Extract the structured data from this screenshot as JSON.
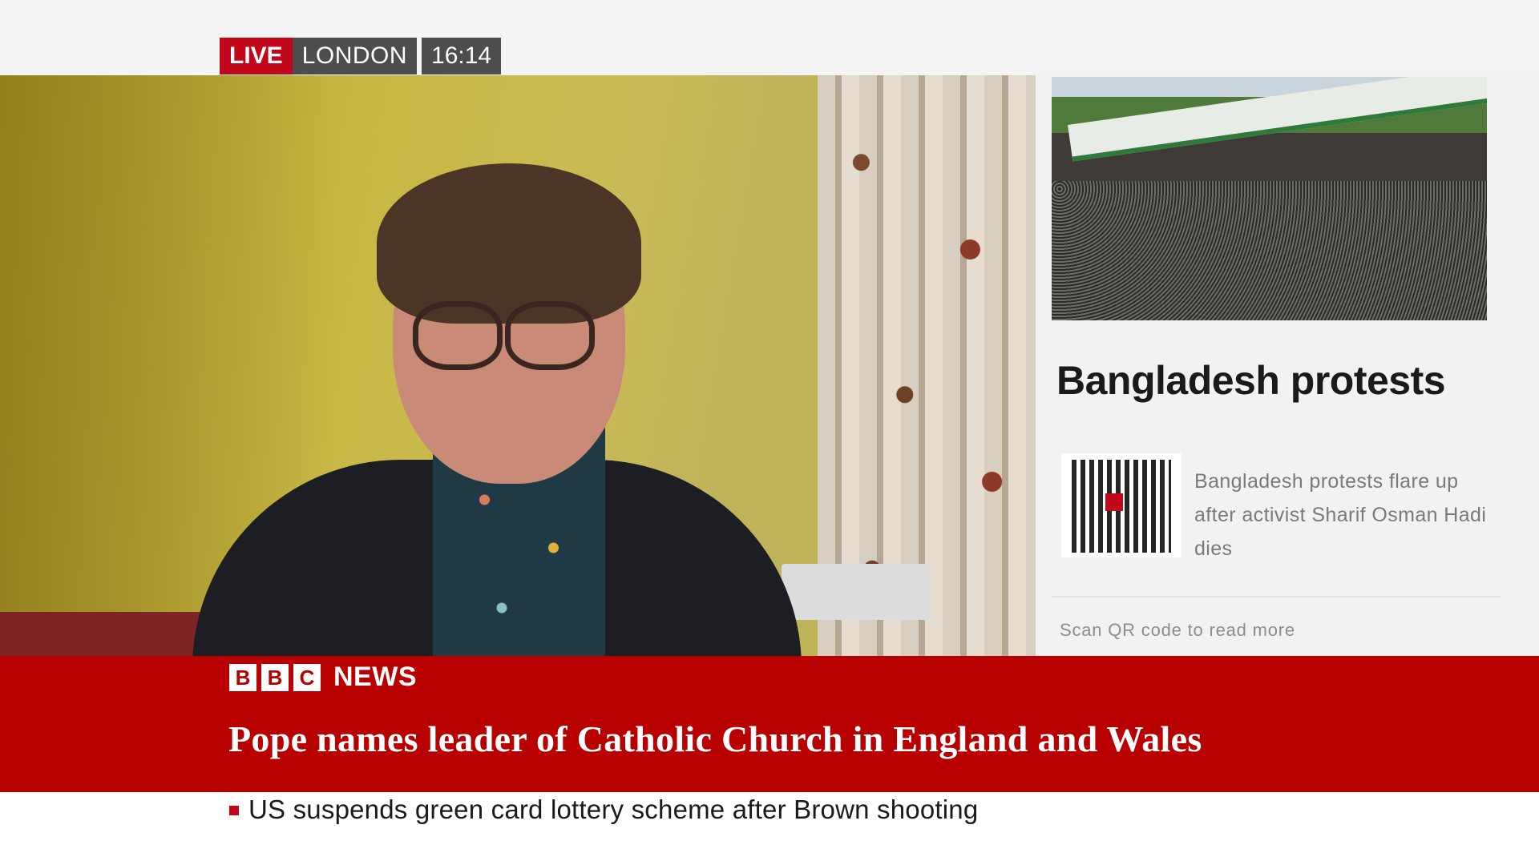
{
  "live_bug": {
    "live": "LIVE",
    "location": "LONDON",
    "time": "16:14"
  },
  "panel": {
    "title": "Bangladesh protests",
    "qr_description": "Bangladesh protests flare up after activist Sharif Osman Hadi dies",
    "scan_note": "Scan QR code to read more"
  },
  "branding": {
    "blocks": [
      "B",
      "B",
      "C"
    ],
    "news": "NEWS"
  },
  "headline": "Pope names leader of Catholic Church in England and Wales",
  "ticker": "US suspends green card lottery scheme after Brown shooting",
  "colors": {
    "bbc_red": "#b80000",
    "live_red": "#c3071b",
    "bug_grey": "#4d4d4d"
  }
}
